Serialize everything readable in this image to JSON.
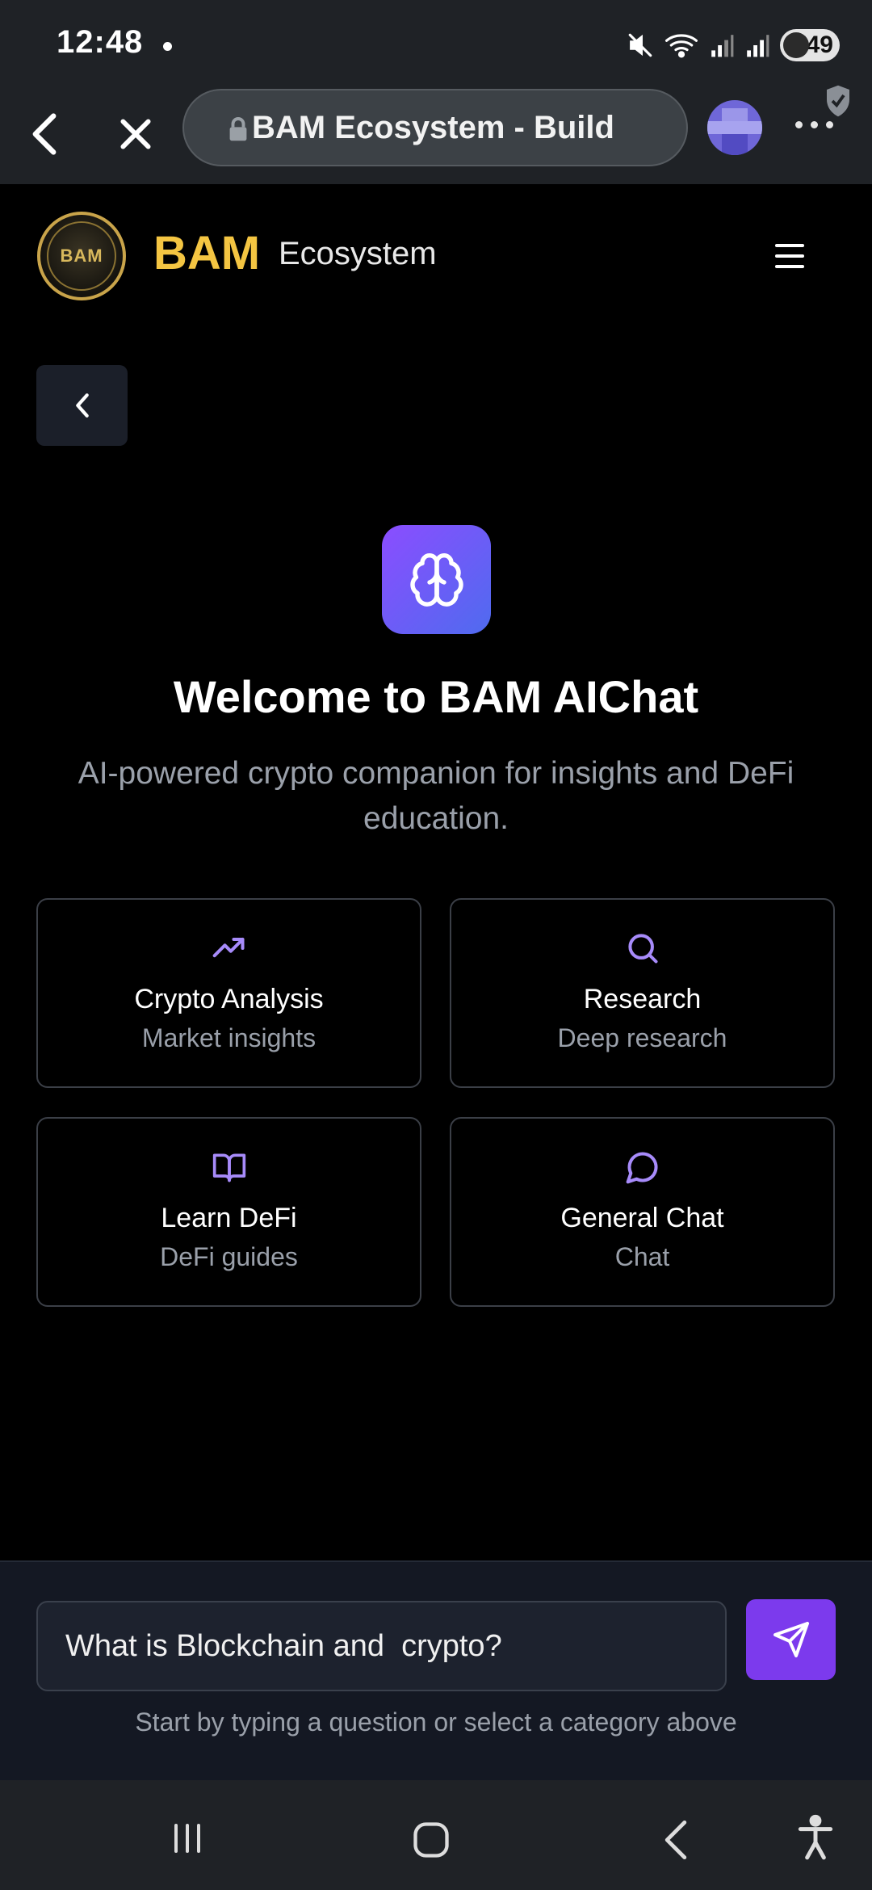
{
  "status_bar": {
    "time": "12:48",
    "battery": "49",
    "icons": [
      "mute-icon",
      "wifi-icon",
      "signal-icon",
      "signal-icon",
      "battery-icon"
    ]
  },
  "browser": {
    "url_title": "BAM Ecosystem - Build",
    "icons": [
      "back-arrow-icon",
      "close-icon",
      "lock-icon",
      "profile-avatar",
      "shield-icon",
      "more-options-icon"
    ]
  },
  "header": {
    "logo_text": "BAM",
    "brand_primary": "BAM",
    "brand_secondary": "Ecosystem"
  },
  "hero": {
    "title": "Welcome to BAM AIChat",
    "subtitle": "AI-powered crypto companion for insights and DeFi education."
  },
  "categories": [
    {
      "title": "Crypto Analysis",
      "subtitle": "Market insights",
      "icon": "trending-up-icon"
    },
    {
      "title": "Research",
      "subtitle": "Deep research",
      "icon": "search-icon"
    },
    {
      "title": "Learn DeFi",
      "subtitle": "DeFi guides",
      "icon": "book-icon"
    },
    {
      "title": "General Chat",
      "subtitle": "Chat",
      "icon": "message-circle-icon"
    }
  ],
  "composer": {
    "input_value": "What is Blockchain and  crypto?",
    "hint": "Start by typing a question or select a category above"
  },
  "colors": {
    "accent_purple": "#7c3aed",
    "brand_gold": "#f4c542",
    "icon_purple": "#a78bfa",
    "background": "#000000"
  }
}
